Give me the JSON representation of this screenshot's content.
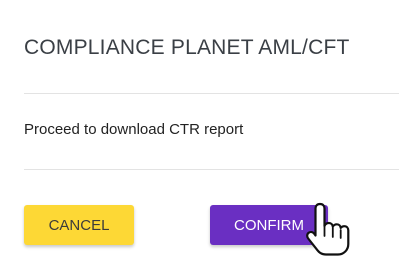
{
  "dialog": {
    "title": "COMPLIANCE PLANET AML/CFT",
    "message": "Proceed to download CTR report"
  },
  "buttons": {
    "cancel_label": "CANCEL",
    "confirm_label": "CONFIRM"
  },
  "colors": {
    "cancel_bg": "#fdd835",
    "confirm_bg": "#6a2fc2"
  },
  "cursor": {
    "icon": "hand-pointer-icon"
  }
}
